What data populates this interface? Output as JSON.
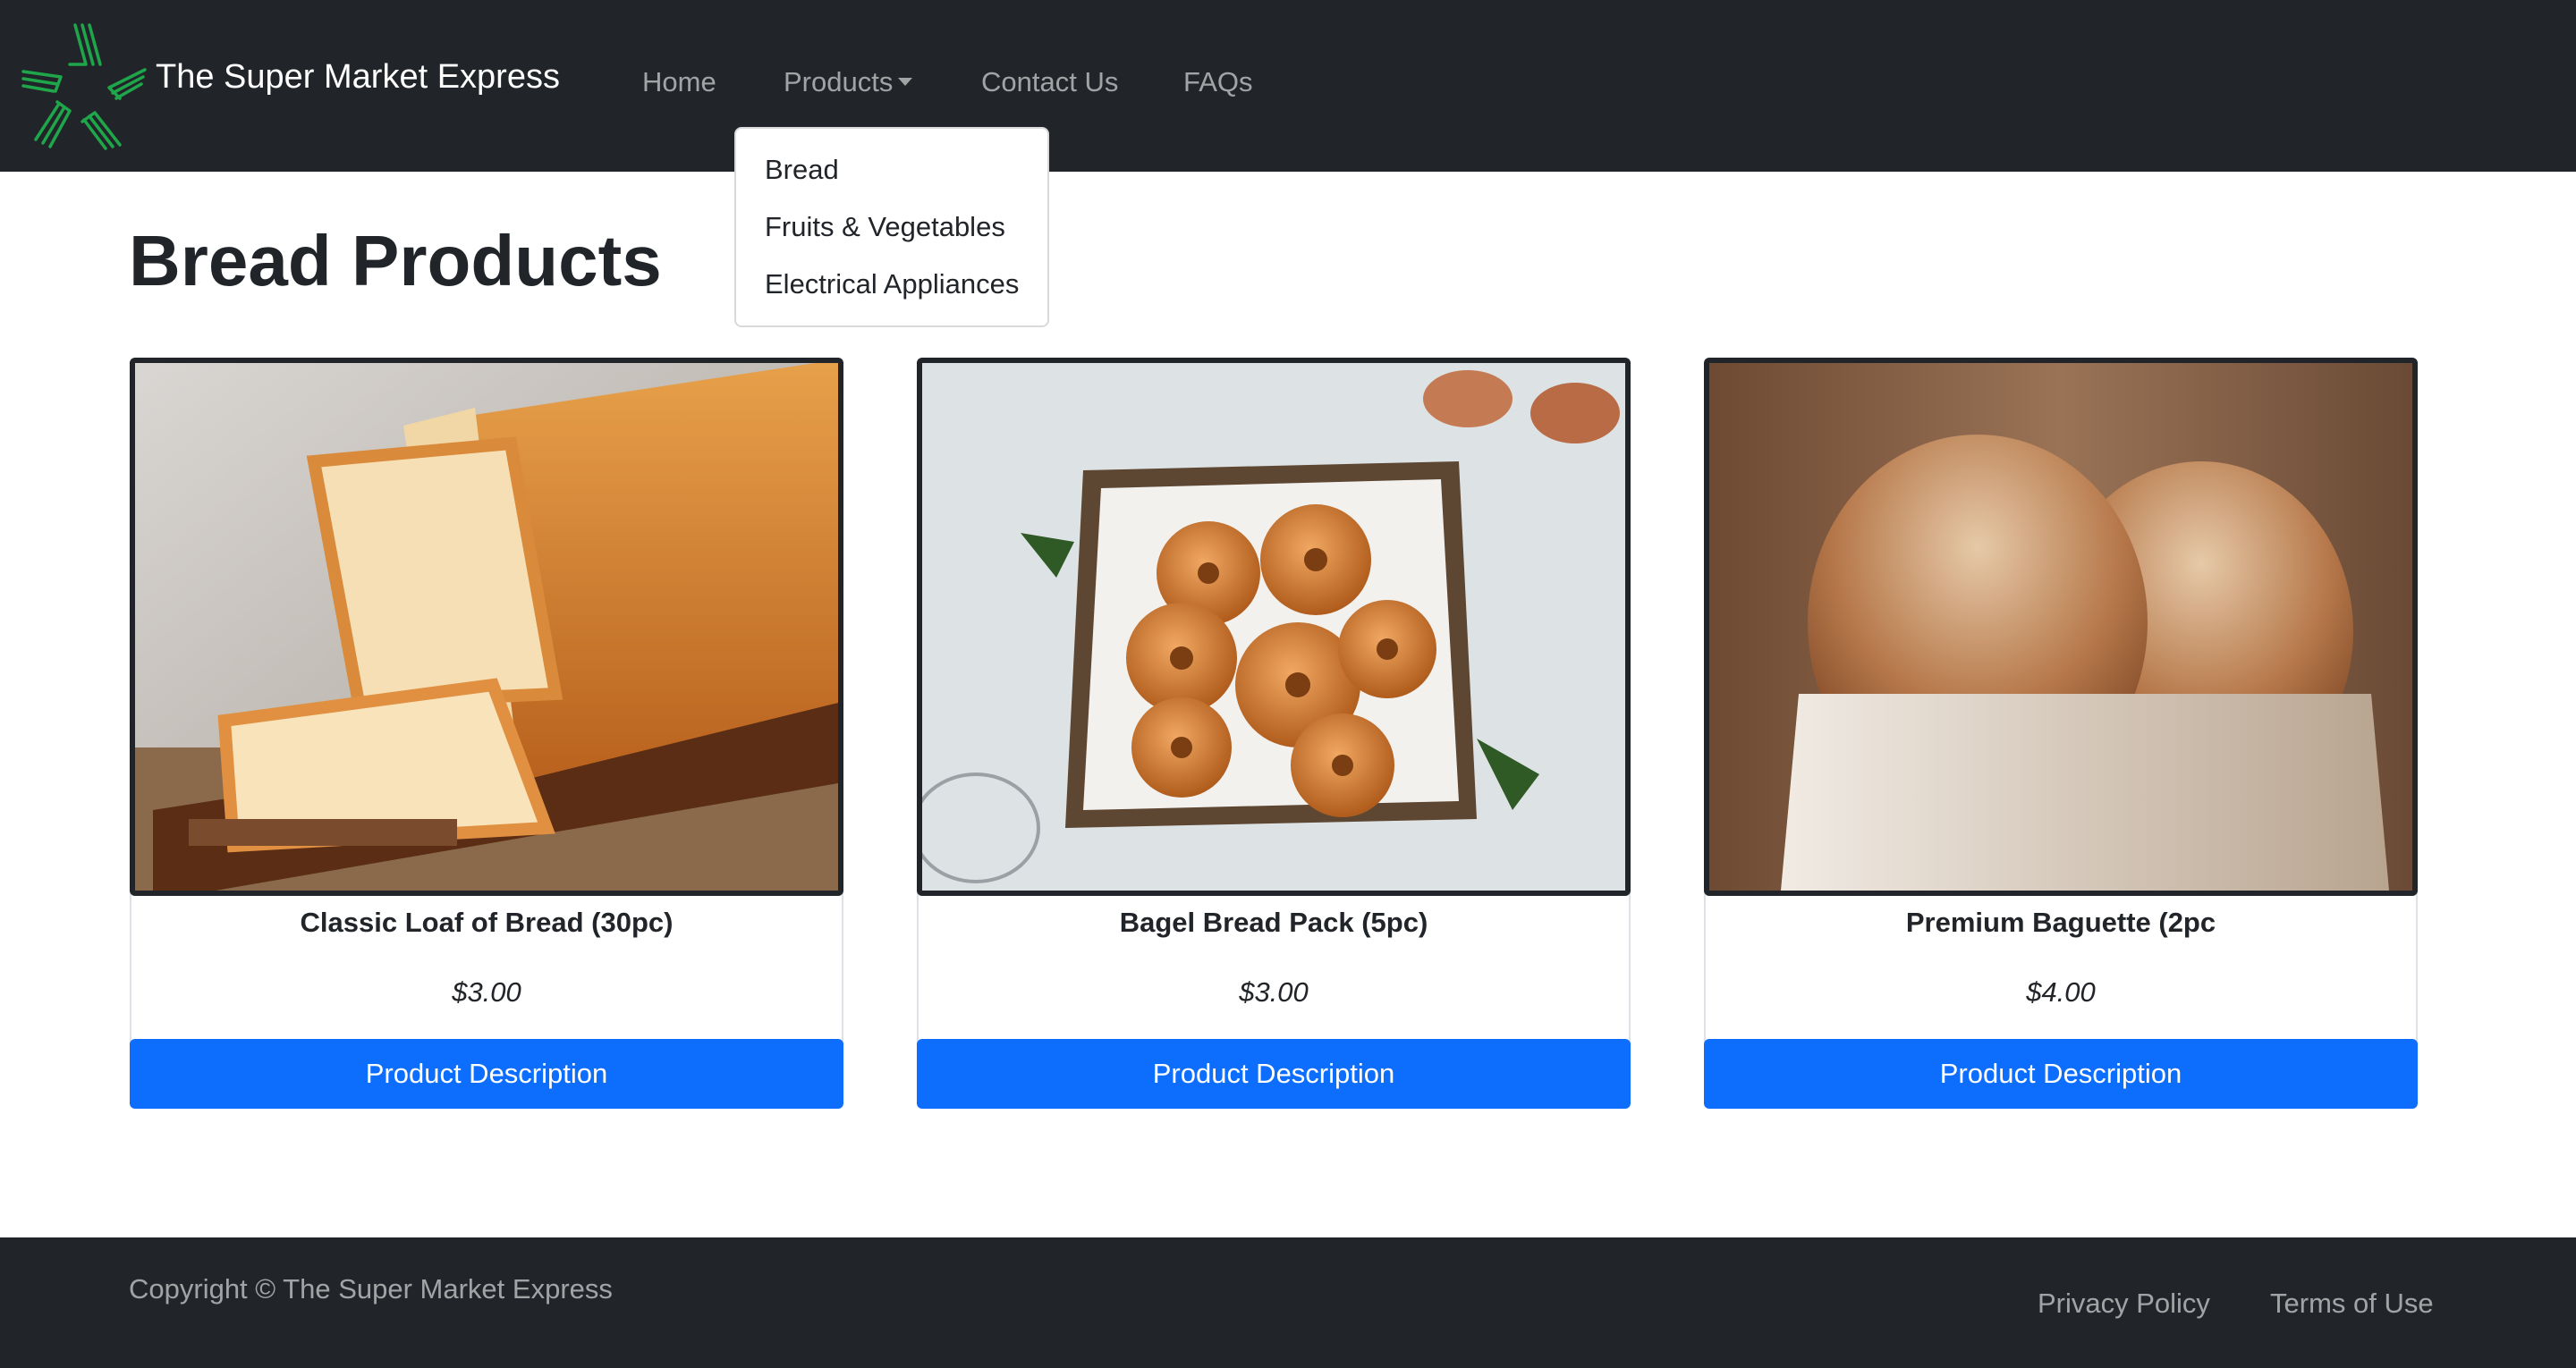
{
  "navbar": {
    "brand": "The Super Market Express",
    "logo_icon": "green-star-logo-icon",
    "links": {
      "home": "Home",
      "products": "Products",
      "contact": "Contact Us",
      "faqs": "FAQs"
    },
    "dropdown": [
      "Bread",
      "Fruits & Vegetables",
      "Electrical Appliances"
    ]
  },
  "page": {
    "title": "Bread Products"
  },
  "products": [
    {
      "name": "Classic Loaf of Bread (30pc)",
      "price": "$3.00",
      "button": "Product Description",
      "image": "sliced-bread-loaf-image"
    },
    {
      "name": "Bagel Bread Pack (5pc)",
      "price": "$3.00",
      "button": "Product Description",
      "image": "bagels-in-basket-image"
    },
    {
      "name": "Premium Baguette (2pc",
      "price": "$4.00",
      "button": "Product Description",
      "image": "bread-in-paper-bag-image"
    }
  ],
  "footer": {
    "copyright": "Copyright © The Super Market Express",
    "privacy": "Privacy Policy",
    "terms": "Terms of Use"
  },
  "colors": {
    "navbar_bg": "#212529",
    "primary_button": "#0d6efd",
    "logo_green": "#1fa64a"
  }
}
